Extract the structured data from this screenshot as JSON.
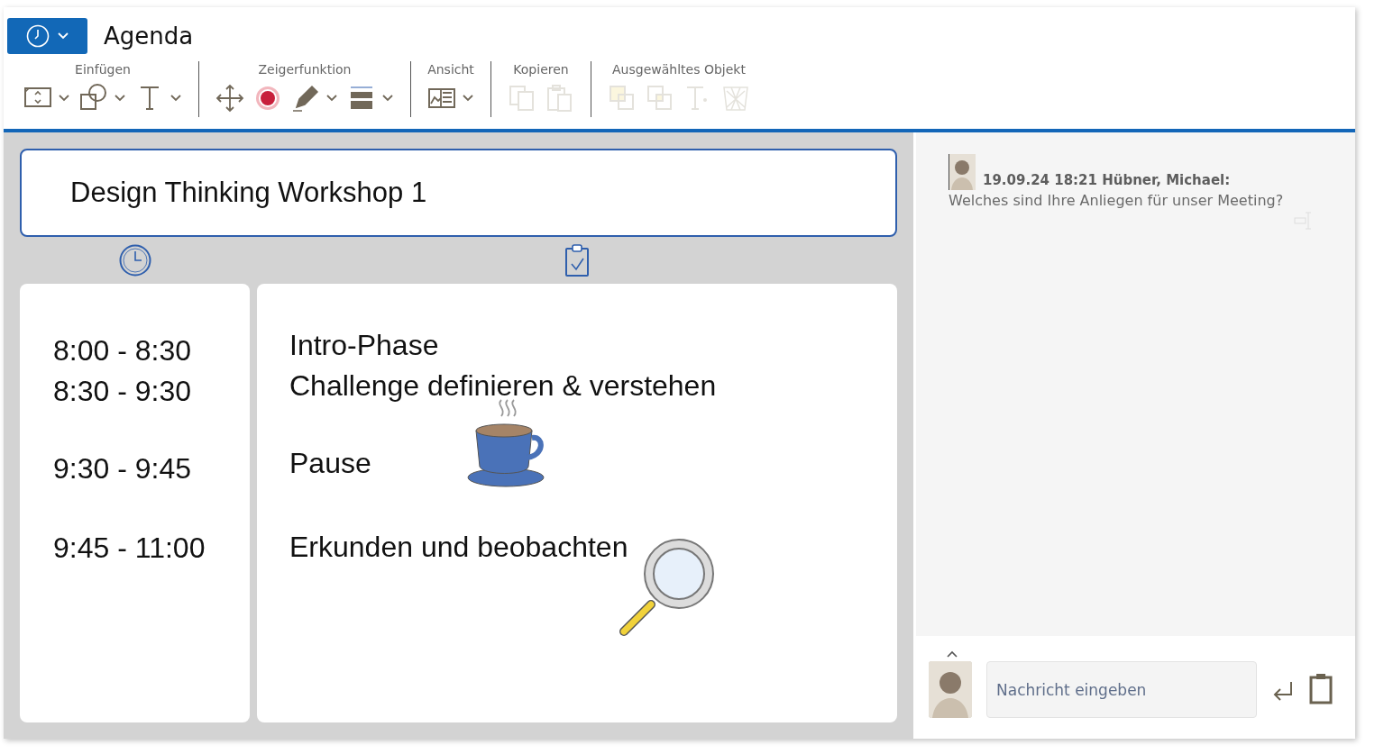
{
  "app_button": {
    "dropdown": true
  },
  "title": "Agenda",
  "toolbar": {
    "groups": [
      {
        "label": "Einfügen",
        "tools": [
          {
            "kind": "frame",
            "dropdown": true,
            "disabled": false
          },
          {
            "kind": "shapes",
            "dropdown": true,
            "disabled": false
          },
          {
            "kind": "text",
            "dropdown": true,
            "disabled": false
          }
        ]
      },
      {
        "label": "Zeigerfunktion",
        "tools": [
          {
            "kind": "move",
            "dropdown": false,
            "disabled": false
          },
          {
            "kind": "target",
            "dropdown": false,
            "disabled": false
          },
          {
            "kind": "pen",
            "dropdown": true,
            "disabled": false
          },
          {
            "kind": "lines",
            "dropdown": true,
            "disabled": false
          }
        ]
      },
      {
        "label": "Ansicht",
        "tools": [
          {
            "kind": "view",
            "dropdown": true,
            "disabled": false
          }
        ]
      },
      {
        "label": "Kopieren",
        "tools": [
          {
            "kind": "copy",
            "dropdown": false,
            "disabled": true
          },
          {
            "kind": "paste",
            "dropdown": false,
            "disabled": true
          }
        ]
      },
      {
        "label": "Ausgewähltes Objekt",
        "tools": [
          {
            "kind": "front",
            "dropdown": false,
            "disabled": true
          },
          {
            "kind": "back",
            "dropdown": false,
            "disabled": true
          },
          {
            "kind": "textformat",
            "dropdown": false,
            "disabled": true
          },
          {
            "kind": "delete",
            "dropdown": false,
            "disabled": true
          }
        ]
      }
    ]
  },
  "board": {
    "heading": "Design Thinking Workshop 1",
    "blocks": [
      {
        "rows": [
          {
            "time": "8:00 - 8:30",
            "topic": "Intro-Phase",
            "kind": "plain"
          },
          {
            "time": "8:30 - 9:30",
            "topic": "Challenge definieren & verstehen",
            "kind": "plain"
          }
        ]
      },
      {
        "rows": [
          {
            "time": "9:30 - 9:45",
            "topic": "Pause",
            "kind": "cup"
          }
        ]
      },
      {
        "rows": [
          {
            "time": "9:45 - 11:00",
            "topic": "Erkunden und beobachten",
            "kind": "magnifier"
          }
        ]
      }
    ]
  },
  "chat": {
    "messages": [
      {
        "meta": "19.09.24 18:21 Hübner, Michael:",
        "text": "Welches sind Ihre Anliegen für unser Meeting?"
      }
    ],
    "input": {
      "placeholder": "Nachricht eingeben"
    }
  }
}
